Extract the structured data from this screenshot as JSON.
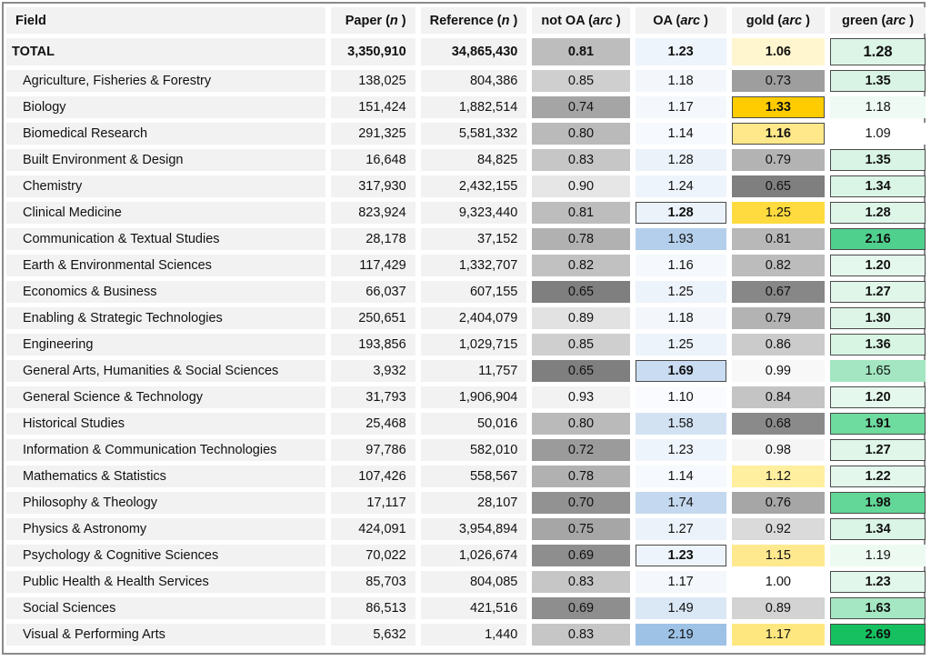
{
  "chart_data": {
    "type": "table",
    "title": "",
    "columns": [
      "Field",
      "Paper (n)",
      "Reference (n)",
      "not OA (arc)",
      "OA (arc)",
      "gold (arc)",
      "green (arc)"
    ],
    "header": {
      "field": "Field",
      "paper": {
        "text": "Paper (",
        "italic": "n",
        "close": ")"
      },
      "reference": {
        "text": "Reference (",
        "italic": "n",
        "close": ")"
      },
      "notoa": {
        "text": "not OA (",
        "italic": "arc",
        "close": ")"
      },
      "oa": {
        "text": "OA (",
        "italic": "arc",
        "close": ")"
      },
      "gold": {
        "text": "gold (",
        "italic": "arc",
        "close": ")"
      },
      "green": {
        "text": "green (",
        "italic": "arc",
        "close": ")"
      }
    },
    "rows": [
      {
        "field": "TOTAL",
        "paper": "3,350,910",
        "reference": "34,865,430",
        "notoa": {
          "v": "0.81",
          "bg": "#bdbdbd",
          "bold": true
        },
        "oa": {
          "v": "1.23",
          "bg": "#eef4fb",
          "bold": true
        },
        "gold": {
          "v": "1.06",
          "bg": "#fff6cf",
          "bold": true
        },
        "green": {
          "v": "1.28",
          "bg": "#dcf5e7",
          "bold": true,
          "boxed": true
        }
      },
      {
        "field": "Agriculture, Fisheries & Forestry",
        "paper": "138,025",
        "reference": "804,386",
        "notoa": {
          "v": "0.85",
          "bg": "#cfcfcf"
        },
        "oa": {
          "v": "1.18",
          "bg": "#f3f7fc"
        },
        "gold": {
          "v": "0.73",
          "bg": "#9e9e9e"
        },
        "green": {
          "v": "1.35",
          "bg": "#d9f4e4",
          "bold": true,
          "boxed": true
        }
      },
      {
        "field": "Biology",
        "paper": "151,424",
        "reference": "1,882,514",
        "notoa": {
          "v": "0.74",
          "bg": "#a5a5a5"
        },
        "oa": {
          "v": "1.17",
          "bg": "#f4f8fc"
        },
        "gold": {
          "v": "1.33",
          "bg": "#ffcc00",
          "bold": true,
          "boxed": true
        },
        "green": {
          "v": "1.18",
          "bg": "#eefaf3"
        }
      },
      {
        "field": "Biomedical Research",
        "paper": "291,325",
        "reference": "5,581,332",
        "notoa": {
          "v": "0.80",
          "bg": "#bababa"
        },
        "oa": {
          "v": "1.14",
          "bg": "#f6f9fd"
        },
        "gold": {
          "v": "1.16",
          "bg": "#ffe88a",
          "bold": true,
          "boxed": true
        },
        "green": {
          "v": "1.09",
          "bg": "#ffffff"
        }
      },
      {
        "field": "Built Environment & Design",
        "paper": "16,648",
        "reference": "84,825",
        "notoa": {
          "v": "0.83",
          "bg": "#c6c6c6"
        },
        "oa": {
          "v": "1.28",
          "bg": "#ebf2fa"
        },
        "gold": {
          "v": "0.79",
          "bg": "#b3b3b3"
        },
        "green": {
          "v": "1.35",
          "bg": "#d9f4e4",
          "bold": true,
          "boxed": true
        }
      },
      {
        "field": "Chemistry",
        "paper": "317,930",
        "reference": "2,432,155",
        "notoa": {
          "v": "0.90",
          "bg": "#e6e6e6"
        },
        "oa": {
          "v": "1.24",
          "bg": "#eef4fb"
        },
        "gold": {
          "v": "0.65",
          "bg": "#7f7f7f"
        },
        "green": {
          "v": "1.34",
          "bg": "#daf4e5",
          "bold": true,
          "boxed": true
        }
      },
      {
        "field": "Clinical Medicine",
        "paper": "823,924",
        "reference": "9,323,440",
        "notoa": {
          "v": "0.81",
          "bg": "#bdbdbd"
        },
        "oa": {
          "v": "1.28",
          "bg": "#ebf2fa",
          "bold": true,
          "boxed": true
        },
        "gold": {
          "v": "1.25",
          "bg": "#ffdb3f"
        },
        "green": {
          "v": "1.28",
          "bg": "#def6e8",
          "bold": true,
          "boxed": true
        }
      },
      {
        "field": "Communication & Textual Studies",
        "paper": "28,178",
        "reference": "37,152",
        "notoa": {
          "v": "0.78",
          "bg": "#b1b1b1"
        },
        "oa": {
          "v": "1.93",
          "bg": "#b4cfeb"
        },
        "gold": {
          "v": "0.81",
          "bg": "#b8b8b8"
        },
        "green": {
          "v": "2.16",
          "bg": "#4fd08d",
          "bold": true,
          "boxed": true
        }
      },
      {
        "field": "Earth & Environmental Sciences",
        "paper": "117,429",
        "reference": "1,332,707",
        "notoa": {
          "v": "0.82",
          "bg": "#c1c1c1"
        },
        "oa": {
          "v": "1.16",
          "bg": "#f5f8fc"
        },
        "gold": {
          "v": "0.82",
          "bg": "#bcbcbc"
        },
        "green": {
          "v": "1.20",
          "bg": "#e5f8ed",
          "bold": true,
          "boxed": true
        }
      },
      {
        "field": "Economics & Business",
        "paper": "66,037",
        "reference": "607,155",
        "notoa": {
          "v": "0.65",
          "bg": "#7f7f7f"
        },
        "oa": {
          "v": "1.25",
          "bg": "#edf3fa"
        },
        "gold": {
          "v": "0.67",
          "bg": "#878787"
        },
        "green": {
          "v": "1.27",
          "bg": "#dff6e9",
          "bold": true,
          "boxed": true
        }
      },
      {
        "field": "Enabling & Strategic Technologies",
        "paper": "250,651",
        "reference": "2,404,079",
        "notoa": {
          "v": "0.89",
          "bg": "#e2e2e2"
        },
        "oa": {
          "v": "1.18",
          "bg": "#f3f7fc"
        },
        "gold": {
          "v": "0.79",
          "bg": "#b3b3b3"
        },
        "green": {
          "v": "1.30",
          "bg": "#ddf5e7",
          "bold": true,
          "boxed": true
        }
      },
      {
        "field": "Engineering",
        "paper": "193,856",
        "reference": "1,029,715",
        "notoa": {
          "v": "0.85",
          "bg": "#cfcfcf"
        },
        "oa": {
          "v": "1.25",
          "bg": "#edf3fa"
        },
        "gold": {
          "v": "0.86",
          "bg": "#cbcbcb"
        },
        "green": {
          "v": "1.36",
          "bg": "#d8f4e3",
          "bold": true,
          "boxed": true
        }
      },
      {
        "field": "General Arts, Humanities & Social Sciences",
        "paper": "3,932",
        "reference": "11,757",
        "notoa": {
          "v": "0.65",
          "bg": "#7f7f7f"
        },
        "oa": {
          "v": "1.69",
          "bg": "#c9dcf1",
          "bold": true,
          "boxed": true
        },
        "gold": {
          "v": "0.99",
          "bg": "#f8f8f8"
        },
        "green": {
          "v": "1.65",
          "bg": "#a3e6c1"
        }
      },
      {
        "field": "General Science & Technology",
        "paper": "31,793",
        "reference": "1,906,904",
        "notoa": {
          "v": "0.93",
          "bg": "#f2f2f2"
        },
        "oa": {
          "v": "1.10",
          "bg": "#f9fbfe"
        },
        "gold": {
          "v": "0.84",
          "bg": "#c4c4c4"
        },
        "green": {
          "v": "1.20",
          "bg": "#e5f8ed",
          "bold": true,
          "boxed": true
        }
      },
      {
        "field": "Historical Studies",
        "paper": "25,468",
        "reference": "50,016",
        "notoa": {
          "v": "0.80",
          "bg": "#bababa"
        },
        "oa": {
          "v": "1.58",
          "bg": "#d2e2f3"
        },
        "gold": {
          "v": "0.68",
          "bg": "#8a8a8a"
        },
        "green": {
          "v": "1.91",
          "bg": "#6edb9f",
          "bold": true,
          "boxed": true
        }
      },
      {
        "field": "Information & Communication Technologies",
        "paper": "97,786",
        "reference": "582,010",
        "notoa": {
          "v": "0.72",
          "bg": "#9b9b9b"
        },
        "oa": {
          "v": "1.23",
          "bg": "#eef4fb"
        },
        "gold": {
          "v": "0.98",
          "bg": "#f5f5f5"
        },
        "green": {
          "v": "1.27",
          "bg": "#dff6e9",
          "bold": true,
          "boxed": true
        }
      },
      {
        "field": "Mathematics & Statistics",
        "paper": "107,426",
        "reference": "558,567",
        "notoa": {
          "v": "0.78",
          "bg": "#b1b1b1"
        },
        "oa": {
          "v": "1.14",
          "bg": "#f6f9fd"
        },
        "gold": {
          "v": "1.12",
          "bg": "#ffef9f"
        },
        "green": {
          "v": "1.22",
          "bg": "#e3f7ec",
          "bold": true,
          "boxed": true
        }
      },
      {
        "field": "Philosophy & Theology",
        "paper": "17,117",
        "reference": "28,107",
        "notoa": {
          "v": "0.70",
          "bg": "#929292"
        },
        "oa": {
          "v": "1.74",
          "bg": "#c4d9ef"
        },
        "gold": {
          "v": "0.76",
          "bg": "#a6a6a6"
        },
        "green": {
          "v": "1.98",
          "bg": "#62d797",
          "bold": true,
          "boxed": true
        }
      },
      {
        "field": "Physics & Astronomy",
        "paper": "424,091",
        "reference": "3,954,894",
        "notoa": {
          "v": "0.75",
          "bg": "#a6a6a6"
        },
        "oa": {
          "v": "1.27",
          "bg": "#ecf2fa"
        },
        "gold": {
          "v": "0.92",
          "bg": "#dadada"
        },
        "green": {
          "v": "1.34",
          "bg": "#daf4e5",
          "bold": true,
          "boxed": true
        }
      },
      {
        "field": "Psychology & Cognitive Sciences",
        "paper": "70,022",
        "reference": "1,026,674",
        "notoa": {
          "v": "0.69",
          "bg": "#8e8e8e"
        },
        "oa": {
          "v": "1.23",
          "bg": "#eef4fb",
          "bold": true,
          "boxed": true
        },
        "gold": {
          "v": "1.15",
          "bg": "#ffe98f"
        },
        "green": {
          "v": "1.19",
          "bg": "#edfaf2"
        }
      },
      {
        "field": "Public Health & Health Services",
        "paper": "85,703",
        "reference": "804,085",
        "notoa": {
          "v": "0.83",
          "bg": "#c6c6c6"
        },
        "oa": {
          "v": "1.17",
          "bg": "#f4f8fc"
        },
        "gold": {
          "v": "1.00",
          "bg": "#ffffff"
        },
        "green": {
          "v": "1.23",
          "bg": "#e2f7eb",
          "bold": true,
          "boxed": true
        }
      },
      {
        "field": "Social Sciences",
        "paper": "86,513",
        "reference": "421,516",
        "notoa": {
          "v": "0.69",
          "bg": "#8e8e8e"
        },
        "oa": {
          "v": "1.49",
          "bg": "#dae7f5"
        },
        "gold": {
          "v": "0.89",
          "bg": "#d3d3d3"
        },
        "green": {
          "v": "1.63",
          "bg": "#a6e7c3",
          "bold": true,
          "boxed": true
        }
      },
      {
        "field": "Visual & Performing Arts",
        "paper": "5,632",
        "reference": "1,440",
        "notoa": {
          "v": "0.83",
          "bg": "#c6c6c6"
        },
        "oa": {
          "v": "2.19",
          "bg": "#9dc2e6"
        },
        "gold": {
          "v": "1.17",
          "bg": "#ffe780"
        },
        "green": {
          "v": "2.69",
          "bg": "#16c060",
          "bold": true,
          "boxed": true
        }
      }
    ]
  }
}
